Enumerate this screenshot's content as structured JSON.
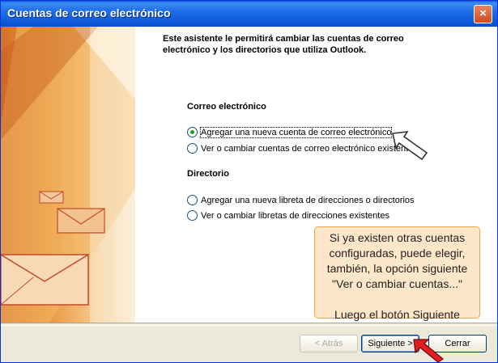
{
  "window": {
    "title": "Cuentas de correo electrónico",
    "close_glyph": "×"
  },
  "intro": "Este asistente le permitirá cambiar las cuentas de correo electrónico y los directorios que utiliza Outlook.",
  "email_section": {
    "title": "Correo electrónico",
    "options": [
      {
        "label": "Agregar una nueva cuenta de correo electrónico",
        "selected": true
      },
      {
        "label": "Ver o cambiar cuentas de correo electrónico existentes",
        "selected": false
      }
    ]
  },
  "directory_section": {
    "title": "Directorio",
    "options": [
      {
        "label": "Agregar una nueva libreta de direcciones o directorios",
        "selected": false
      },
      {
        "label": "Ver o cambiar libretas de direcciones existentes",
        "selected": false
      }
    ]
  },
  "note": {
    "text": "Si ya existen otras cuentas\nconfiguradas, puede elegir,\ntambién, la opción siguiente\n\"Ver o cambiar cuentas...\"\n\nLuego el botón Siguiente"
  },
  "buttons": {
    "back": "< Atrás",
    "next": "Siguiente >",
    "close": "Cerrar"
  },
  "colors": {
    "title_bar": "#0b58d8",
    "note_bg": "#fee7c9",
    "note_border": "#f4a44a",
    "pointer_red": "#e02020"
  }
}
